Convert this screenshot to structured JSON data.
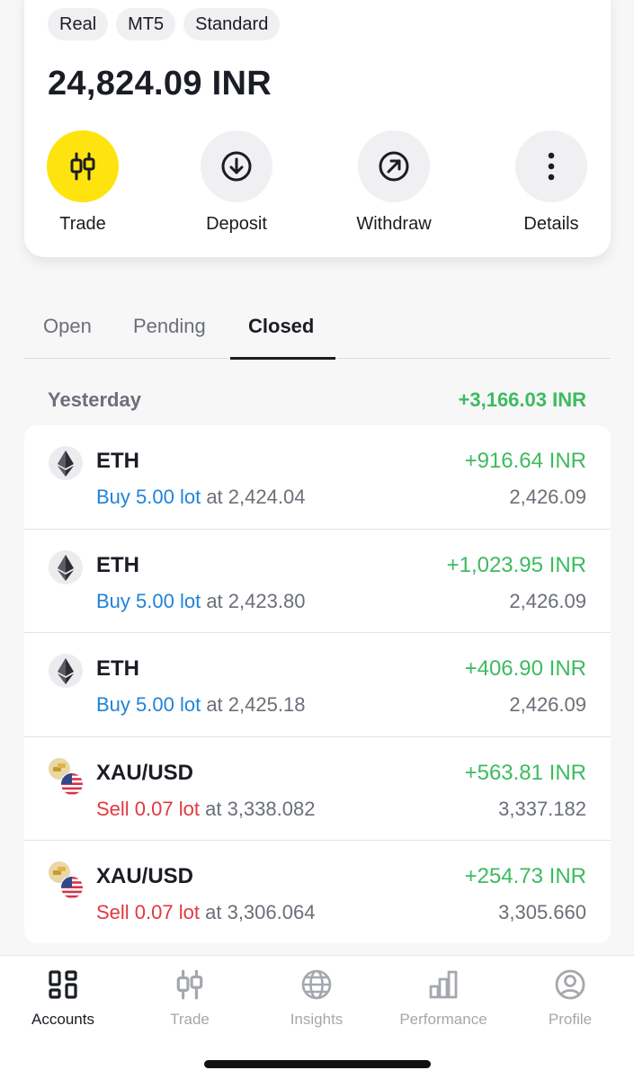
{
  "account": {
    "tags": [
      "Real",
      "MT5",
      "Standard"
    ],
    "balance": "24,824.09 INR",
    "actions": [
      {
        "label": "Trade",
        "icon": "candlestick-icon"
      },
      {
        "label": "Deposit",
        "icon": "arrow-down-circle-icon"
      },
      {
        "label": "Withdraw",
        "icon": "arrow-up-right-circle-icon"
      },
      {
        "label": "Details",
        "icon": "more-vertical-icon"
      }
    ]
  },
  "tabs": {
    "open": "Open",
    "pending": "Pending",
    "closed": "Closed",
    "active": "Closed"
  },
  "group": {
    "label": "Yesterday",
    "total": "+3,166.03 INR"
  },
  "trades": [
    {
      "symbol": "ETH",
      "icon": "ethereum-icon",
      "side": "Buy 5.00 lot",
      "side_type": "buy",
      "at": "at",
      "open_price": "2,424.04",
      "pnl": "+916.64 INR",
      "close_price": "2,426.09"
    },
    {
      "symbol": "ETH",
      "icon": "ethereum-icon",
      "side": "Buy 5.00 lot",
      "side_type": "buy",
      "at": "at",
      "open_price": "2,423.80",
      "pnl": "+1,023.95 INR",
      "close_price": "2,426.09"
    },
    {
      "symbol": "ETH",
      "icon": "ethereum-icon",
      "side": "Buy 5.00 lot",
      "side_type": "buy",
      "at": "at",
      "open_price": "2,425.18",
      "pnl": "+406.90 INR",
      "close_price": "2,426.09"
    },
    {
      "symbol": "XAU/USD",
      "icon": "gold-usd-flag-icon",
      "side": "Sell 0.07 lot",
      "side_type": "sell",
      "at": "at",
      "open_price": "3,338.082",
      "pnl": "+563.81 INR",
      "close_price": "3,337.182"
    },
    {
      "symbol": "XAU/USD",
      "icon": "gold-usd-flag-icon",
      "side": "Sell 0.07 lot",
      "side_type": "sell",
      "at": "at",
      "open_price": "3,306.064",
      "pnl": "+254.73 INR",
      "close_price": "3,305.660"
    }
  ],
  "nav": [
    {
      "label": "Accounts",
      "icon": "accounts-grid-icon",
      "active": true
    },
    {
      "label": "Trade",
      "icon": "candlestick-icon",
      "active": false
    },
    {
      "label": "Insights",
      "icon": "globe-icon",
      "active": false
    },
    {
      "label": "Performance",
      "icon": "bar-chart-icon",
      "active": false
    },
    {
      "label": "Profile",
      "icon": "user-circle-icon",
      "active": false
    }
  ],
  "colors": {
    "accent_yellow": "#ffe30f",
    "profit_green": "#3dbb5f",
    "buy_blue": "#1f83d8",
    "sell_red": "#e0393e"
  }
}
